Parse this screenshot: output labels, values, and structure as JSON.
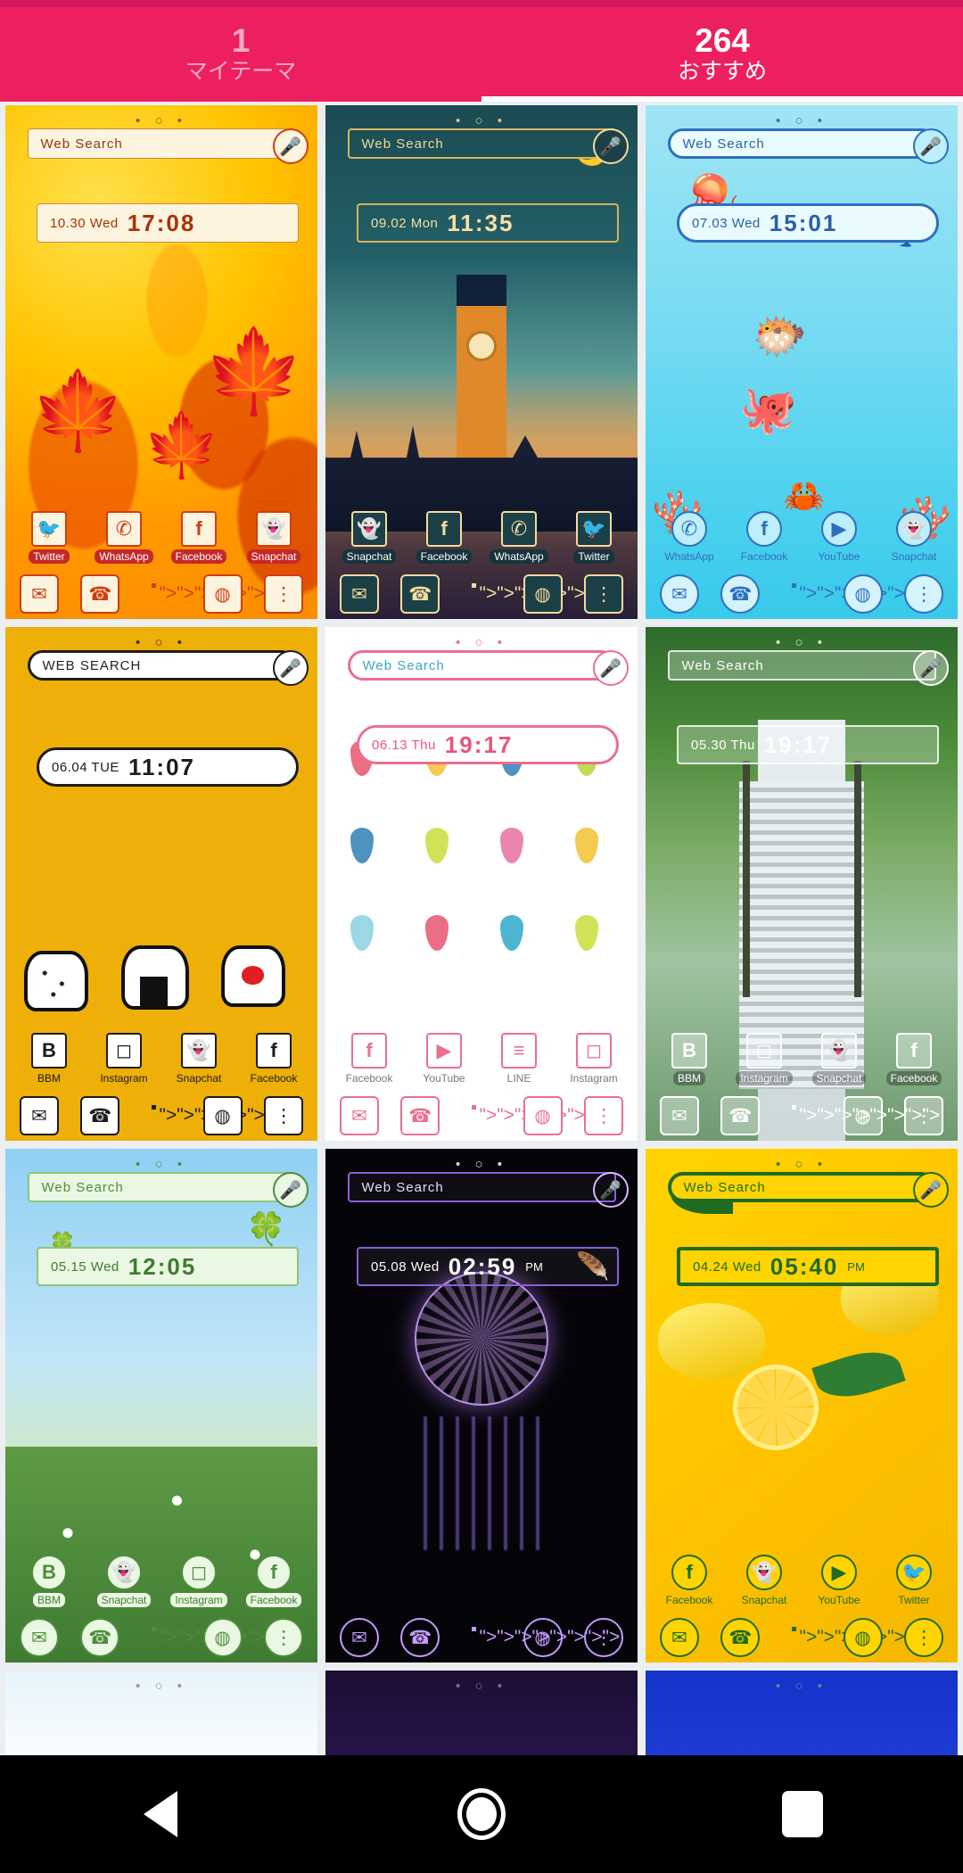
{
  "header": {
    "accent_color": "#ec205f",
    "status_color": "#d41a5c",
    "tabs": [
      {
        "count": "1",
        "label": "マイテーマ",
        "active": false
      },
      {
        "count": "264",
        "label": "おすすめ",
        "active": true
      }
    ]
  },
  "grid": {
    "columns": 3,
    "themes": [
      {
        "id": "autumn-maple",
        "style": "maple",
        "dots": "• ○ •",
        "search_label": "Web Search",
        "date": "10.30 Wed",
        "time": "17:08",
        "apps": [
          "Twitter",
          "WhatsApp",
          "Facebook",
          "Snapchat"
        ],
        "dock": [
          "mail-icon",
          "phone-icon",
          "apps-icon",
          "browser-icon",
          "more-icon"
        ]
      },
      {
        "id": "london-bigben",
        "style": "london",
        "dots": "• ○ •",
        "search_label": "Web Search",
        "date": "09.02 Mon",
        "time": "11:35",
        "apps": [
          "Snapchat",
          "Facebook",
          "WhatsApp",
          "Twitter"
        ],
        "dock": [
          "mail-icon",
          "phone-icon",
          "apps-icon",
          "browser-icon",
          "more-icon"
        ]
      },
      {
        "id": "ocean-creatures",
        "style": "ocean",
        "dots": "• ○ •",
        "search_label": "Web Search",
        "date": "07.03 Wed",
        "time": "15:01",
        "apps": [
          "WhatsApp",
          "Facebook",
          "YouTube",
          "Snapchat"
        ],
        "dock": [
          "mail-icon",
          "phone-icon",
          "apps-icon",
          "browser-icon",
          "more-icon"
        ]
      },
      {
        "id": "onigiri-yellow",
        "style": "onigiri",
        "dots": "• ○ •",
        "search_label": "WEB SEARCH",
        "date": "06.04 TUE",
        "time": "11:07",
        "apps": [
          "BBM",
          "Instagram",
          "Snapchat",
          "Facebook"
        ],
        "dock": [
          "mail-icon",
          "phone-icon",
          "apps-icon",
          "browser-icon",
          "more-icon"
        ]
      },
      {
        "id": "watercolor-raindrops",
        "style": "rain",
        "dots": "• ○ •",
        "search_label": "Web Search",
        "date": "06.13 Thu",
        "time": "19:17",
        "apps": [
          "Facebook",
          "YouTube",
          "LINE",
          "Instagram"
        ],
        "dock": [
          "mail-icon",
          "phone-icon",
          "apps-icon",
          "browser-icon",
          "more-icon"
        ]
      },
      {
        "id": "green-bridge",
        "style": "bridge",
        "dots": "• ○ •",
        "search_label": "Web Search",
        "date": "05.30 Thu",
        "time": "19:17",
        "apps": [
          "BBM",
          "Instagram",
          "Snapchat",
          "Facebook"
        ],
        "dock": [
          "mail-icon",
          "phone-icon",
          "apps-icon",
          "browser-icon",
          "more-icon"
        ]
      },
      {
        "id": "clover-sky",
        "style": "clover",
        "dots": "• ○ •",
        "search_label": "Web Search",
        "date": "05.15 Wed",
        "time": "12:05",
        "apps": [
          "BBM",
          "Snapchat",
          "Instagram",
          "Facebook"
        ],
        "dock": [
          "mail-icon",
          "phone-icon",
          "apps-icon",
          "browser-icon",
          "more-icon"
        ]
      },
      {
        "id": "dreamcatcher-night",
        "style": "dream",
        "dots": "• ○ •",
        "search_label": "Web Search",
        "date": "05.08 Wed",
        "time": "02:59",
        "meridiem": "PM",
        "apps": [],
        "dock": [
          "mail-icon",
          "phone-icon",
          "apps-icon",
          "browser-icon",
          "more-icon"
        ]
      },
      {
        "id": "lemon-fresh",
        "style": "lemon",
        "dots": "• ○ •",
        "search_label": "Web Search",
        "date": "04.24 Wed",
        "time": "05:40",
        "meridiem": "PM",
        "apps": [
          "Facebook",
          "Snapchat",
          "YouTube",
          "Twitter"
        ],
        "dock": [
          "mail-icon",
          "phone-icon",
          "apps-icon",
          "browser-icon",
          "more-icon"
        ]
      },
      {
        "id": "partial-white",
        "style": "p1",
        "dots": "• ○ •"
      },
      {
        "id": "partial-night",
        "style": "p2",
        "dots": "• ○ •"
      },
      {
        "id": "partial-blue",
        "style": "p3",
        "dots": "• ○ •"
      }
    ]
  },
  "navbar": {
    "back_label": "back-button",
    "home_label": "home-button",
    "recents_label": "recents-button"
  }
}
